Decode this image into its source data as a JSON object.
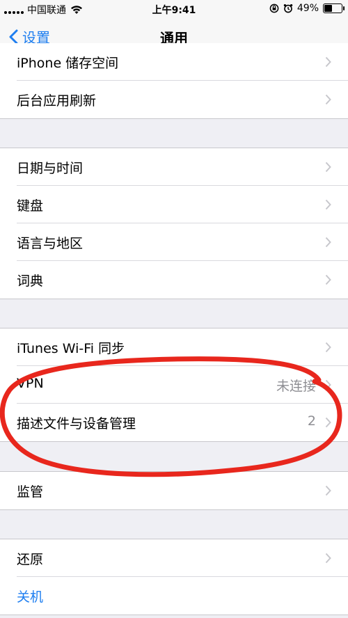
{
  "status_bar": {
    "carrier": "中国联通",
    "time": "上午9:41",
    "battery_percent": "49%",
    "battery_level": 0.49
  },
  "nav": {
    "back_label": "设置",
    "title": "通用"
  },
  "rows": [
    {
      "label": "iPhone 储存空间"
    },
    {
      "label": "后台应用刷新"
    },
    {
      "label": "日期与时间"
    },
    {
      "label": "键盘"
    },
    {
      "label": "语言与地区"
    },
    {
      "label": "词典"
    },
    {
      "label": "iTunes Wi-Fi 同步"
    },
    {
      "label": "VPN",
      "value": "未连接"
    },
    {
      "label": "描述文件与设备管理",
      "value": "2"
    },
    {
      "label": "监管"
    },
    {
      "label": "还原"
    },
    {
      "label": "关机",
      "color": "#1e7ef0"
    }
  ],
  "colors": {
    "accent": "#1e7ef0",
    "annotation": "#e8271d"
  },
  "icons": {
    "wifi": "wifi-icon",
    "rotation_lock": "rotation-lock-icon",
    "alarm": "alarm-icon",
    "battery": "battery-icon",
    "back": "chevron-left-icon",
    "disclosure": "chevron-right-icon"
  }
}
